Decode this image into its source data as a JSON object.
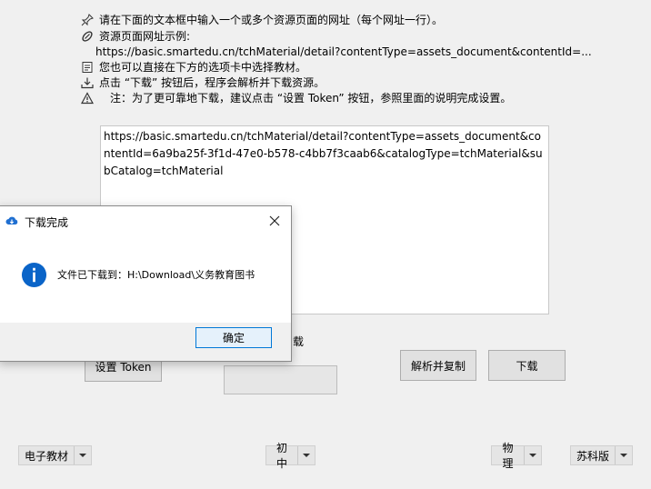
{
  "instructions": {
    "line1": "请在下面的文本框中输入一个或多个资源页面的网址（每个网址一行）。",
    "line2": "资源页面网址示例:",
    "line3": "https://basic.smartedu.cn/tchMaterial/detail?contentType=assets_document&contentId=...",
    "line4": "您也可以直接在下方的选项卡中选择教材。",
    "line5": "点击 “下载” 按钮后，程序会解析并下载资源。",
    "line6": "注：为了更可靠地下载，建议点击 “设置 Token” 按钮，参照里面的说明完成设置。"
  },
  "icons": {
    "line1": "pin-icon",
    "line2": "link-icon",
    "line4": "notepad-icon",
    "line5": "download-tray-icon",
    "line6": "warning-icon"
  },
  "url_input": {
    "value": "https://basic.smartedu.cn/tchMaterial/detail?contentType=assets_document&contentId=6a9ba25f-3f1d-47e0-b578-c4bb7f3caab6&catalogType=tchMaterial&subCatalog=tchMaterial"
  },
  "buttons": {
    "set_token": "设置 Token",
    "parse_copy": "解析并复制",
    "download": "下载"
  },
  "partial_label": "载",
  "selectors": {
    "category": "电子教材",
    "level": "初中",
    "subject": "物理",
    "edition": "苏科版"
  },
  "dialog": {
    "title": "下载完成",
    "message": "文件已下载到：H:\\Download\\义务教育图书",
    "ok_label": "确定"
  },
  "colors": {
    "info_blue": "#0a64c8",
    "focus_blue": "#0078d7"
  }
}
